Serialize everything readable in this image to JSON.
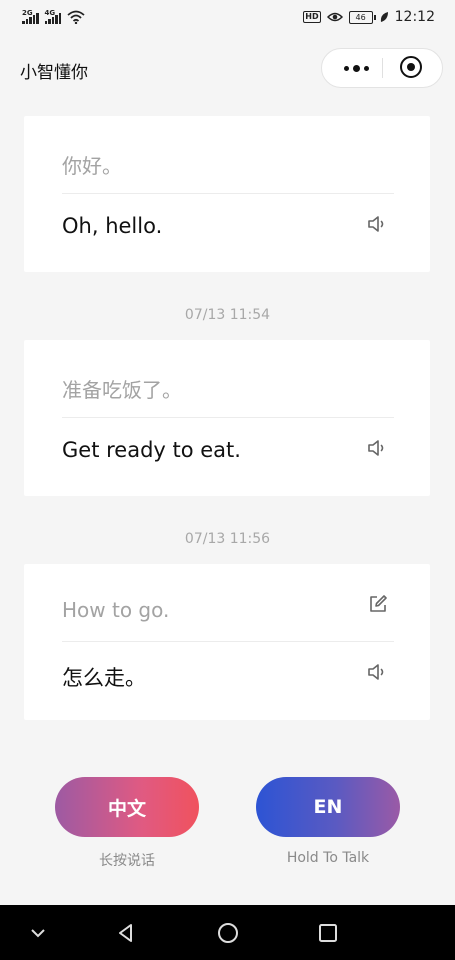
{
  "status_bar": {
    "sim1_tag": "2G",
    "sim2_tag": "4G",
    "hd": "HD",
    "battery": "46",
    "time": "12:12"
  },
  "header": {
    "title": "小智懂你"
  },
  "conversation": [
    {
      "timestamp": "",
      "source_text": "你好。",
      "translation": "Oh, hello.",
      "editable": false
    },
    {
      "timestamp": "07/13 11:54",
      "source_text": "准备吃饭了。",
      "translation": "Get ready to eat.",
      "editable": false
    },
    {
      "timestamp": "07/13 11:56",
      "source_text": "How to go.",
      "translation": "怎么走。",
      "editable": true
    }
  ],
  "controls": {
    "zh_button": "中文",
    "zh_hint": "长按说话",
    "en_button": "EN",
    "en_hint": "Hold To Talk"
  },
  "icons": {
    "speaker": "speaker-icon",
    "edit": "edit-icon",
    "more": "more-dots-icon",
    "close": "close-mini-program-icon"
  }
}
